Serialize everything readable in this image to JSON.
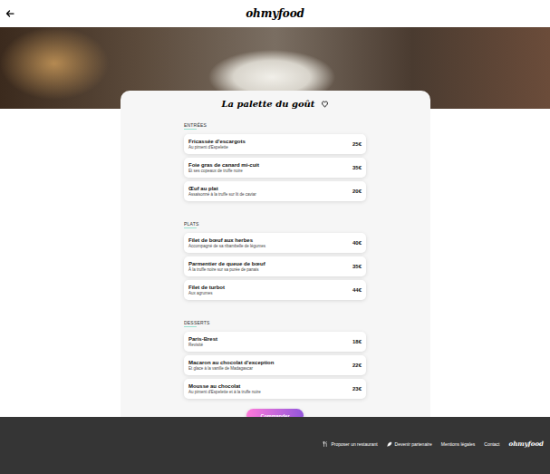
{
  "header": {
    "logo": "ohmyfood"
  },
  "restaurant": {
    "name": "La palette du goût",
    "favorite": false
  },
  "sections": [
    {
      "title": "ENTRÉES",
      "items": [
        {
          "name": "Fricassée d'escargots",
          "description": "Au piment d'Espelette",
          "price": "25€"
        },
        {
          "name": "Foie gras de canard mi-cuit",
          "description": "Et ses copeaux de truffe noire",
          "price": "35€"
        },
        {
          "name": "Œuf au plat",
          "description": "Assaisonné à la truffe sur lit de caviar",
          "price": "20€"
        }
      ]
    },
    {
      "title": "PLATS",
      "items": [
        {
          "name": "Filet de bœuf aux herbes",
          "description": "Accompagné de sa ribambelle de légumes",
          "price": "40€"
        },
        {
          "name": "Parmentier de queue de bœuf",
          "description": "À la truffe noire sur sa purée de panais",
          "price": "35€"
        },
        {
          "name": "Filet de turbot",
          "description": "Aux agrumes",
          "price": "44€"
        }
      ]
    },
    {
      "title": "DESSERTS",
      "items": [
        {
          "name": "Paris-Brest",
          "description": "Revisité",
          "price": "18€"
        },
        {
          "name": "Macaron au chocolat d'exception",
          "description": "Et glace à la vanille de Madagascar",
          "price": "22€"
        },
        {
          "name": "Mousse au chocolat",
          "description": "Au piment d'Espelette et à la truffe noire",
          "price": "23€"
        }
      ]
    }
  ],
  "order_button": "Commander",
  "footer": {
    "links": [
      {
        "label": "Proposer un restaurant",
        "kind": "restaurant"
      },
      {
        "label": "Devenir partenaire",
        "kind": "partner"
      },
      {
        "label": "Mentions légales",
        "kind": "plain"
      },
      {
        "label": "Contact",
        "kind": "plain"
      }
    ],
    "logo": "ohmyfood"
  }
}
